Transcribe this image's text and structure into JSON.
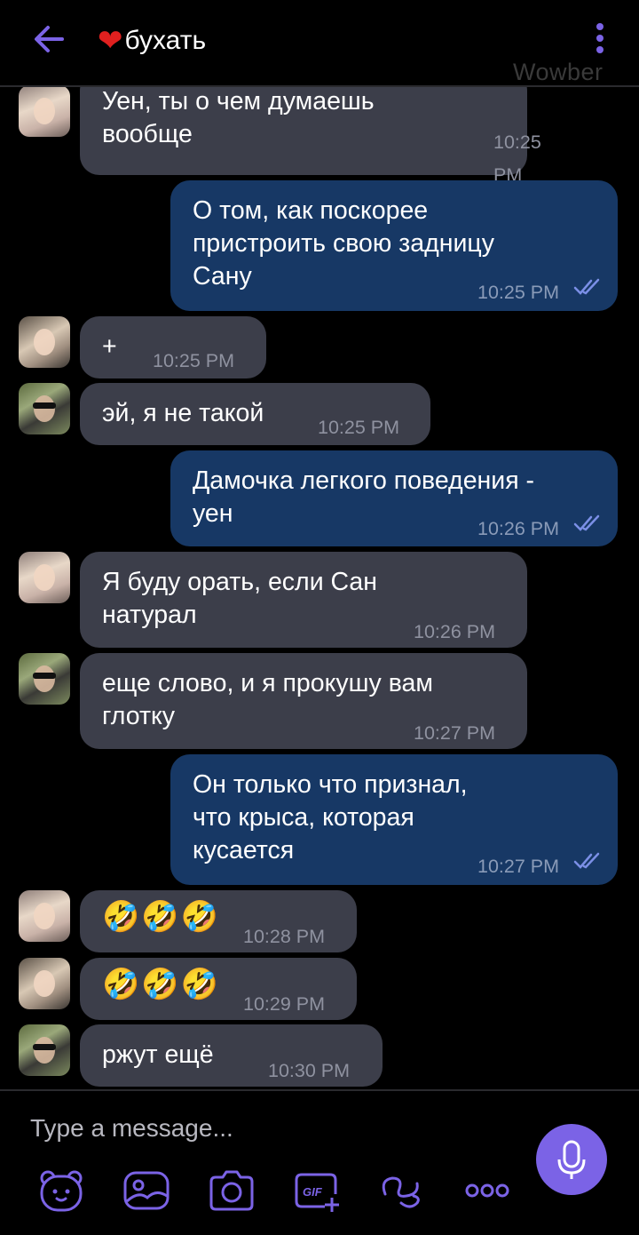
{
  "header": {
    "title_emoji": "❤",
    "title": "бухать",
    "watermark": "Wowber"
  },
  "messages": [
    {
      "dir": "in",
      "avatar": "a",
      "text": "Уен, ты о чем думаешь\nвообще",
      "time": "10:25 PM"
    },
    {
      "dir": "out",
      "text": "О том, как поскорее\nпристроить свою задницу\nСану",
      "time": "10:25 PM",
      "status": "read"
    },
    {
      "dir": "in",
      "avatar": "b",
      "text": "+",
      "time": "10:25 PM"
    },
    {
      "dir": "in",
      "avatar": "c",
      "text": "эй, я не такой",
      "time": "10:25 PM"
    },
    {
      "dir": "out",
      "text": "Дамочка легкого поведения -\nуен",
      "time": "10:26 PM",
      "status": "read"
    },
    {
      "dir": "in",
      "avatar": "a",
      "text": "Я буду орать, если Сан\nнатурал",
      "time": "10:26 PM"
    },
    {
      "dir": "in",
      "avatar": "c",
      "text": "еще слово, и я прокушу вам\nглотку",
      "time": "10:27 PM"
    },
    {
      "dir": "out",
      "text": "Он только что признал,\nчто крыса, которая\nкусается",
      "time": "10:27 PM",
      "status": "read"
    },
    {
      "dir": "in",
      "avatar": "a",
      "text": "🤣🤣🤣",
      "time": "10:28 PM",
      "emoji": true
    },
    {
      "dir": "in",
      "avatar": "b",
      "text": "🤣🤣🤣",
      "time": "10:29 PM",
      "emoji": true
    },
    {
      "dir": "in",
      "avatar": "c",
      "text": "ржут ещё",
      "time": "10:30 PM"
    }
  ],
  "composer": {
    "placeholder": "Type a message...",
    "tools": [
      "sticker-icon",
      "gallery-icon",
      "camera-icon",
      "gif-icon",
      "doodle-icon",
      "more-icon"
    ]
  },
  "colors": {
    "accent": "#7b63e6",
    "incoming_bubble": "#3c3e4a",
    "outgoing_bubble": "#173865",
    "background": "#000000"
  }
}
